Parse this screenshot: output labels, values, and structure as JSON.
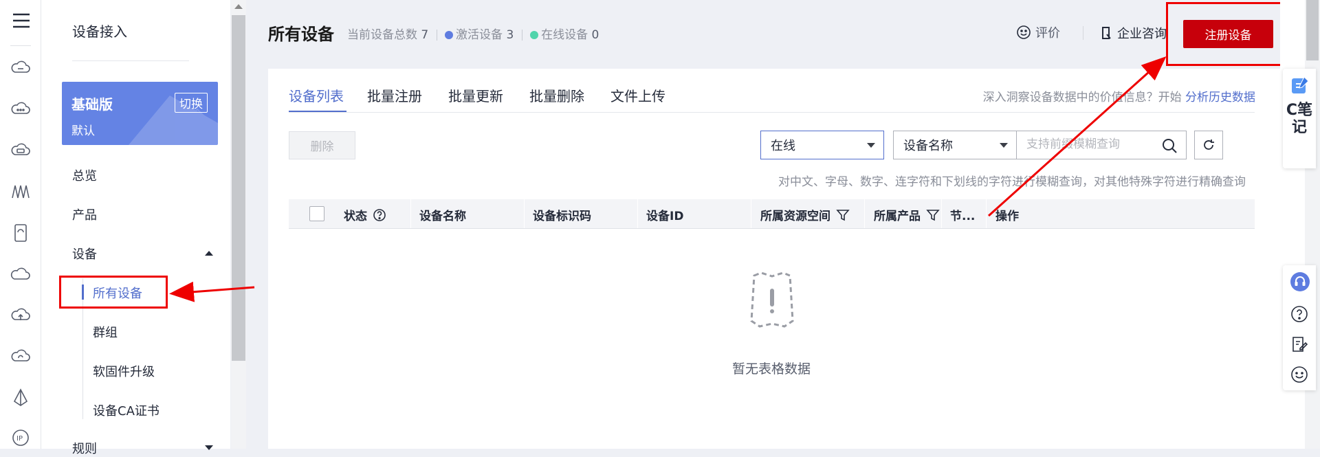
{
  "rail": {
    "icons": [
      "menu-icon",
      "cloud-chat-icon",
      "cloud-dots-icon",
      "cloud-box-icon",
      "wave-icon",
      "device-frame-icon",
      "cloud-outline-icon",
      "cloud-upload-icon",
      "cloud-refresh-icon",
      "sail-icon",
      "ip-icon"
    ]
  },
  "sidenav": {
    "title": "设备接入",
    "edition": {
      "name": "基础版",
      "switch_label": "切换",
      "sub": "默认"
    },
    "items": {
      "overview": "总览",
      "product": "产品",
      "device": "设备",
      "rules": "规则"
    },
    "sub_items": [
      "所有设备",
      "群组",
      "软固件升级",
      "设备CA证书"
    ]
  },
  "header": {
    "title": "所有设备",
    "total_label": "当前设备总数",
    "total": "7",
    "active_label": "激活设备",
    "active": "3",
    "online_label": "在线设备",
    "online": "0",
    "rate_label": "评价",
    "consult_label": "企业咨询",
    "register_label": "注册设备"
  },
  "tabs": [
    "设备列表",
    "批量注册",
    "批量更新",
    "批量删除",
    "文件上传"
  ],
  "insight": {
    "text": "深入洞察设备数据中的价值信息？开始",
    "link": "分析历史数据"
  },
  "toolbar": {
    "delete_label": "删除",
    "status_filter": "在线",
    "field_filter": "设备名称",
    "search_placeholder": "支持前缀模糊查询",
    "hint": "对中文、字母、数字、连字符和下划线的字符进行模糊查询，对其他特殊字符进行精确查询"
  },
  "table": {
    "columns": [
      "状态",
      "设备名称",
      "设备标识码",
      "设备ID",
      "所属资源空间",
      "所属产品",
      "节...",
      "操作"
    ],
    "empty_text": "暂无表格数据"
  },
  "right_panel": {
    "note_text": "C笔记",
    "tools": [
      "headset-icon",
      "help-icon",
      "feedback-icon",
      "smile-icon"
    ]
  },
  "colors": {
    "accent": "#526ecc",
    "brand_red": "#c7000b",
    "edition_bg": "#6483e4",
    "active_dot": "#5e7ce0",
    "online_dot": "#50d4ab",
    "annotation": "#ee0000"
  }
}
